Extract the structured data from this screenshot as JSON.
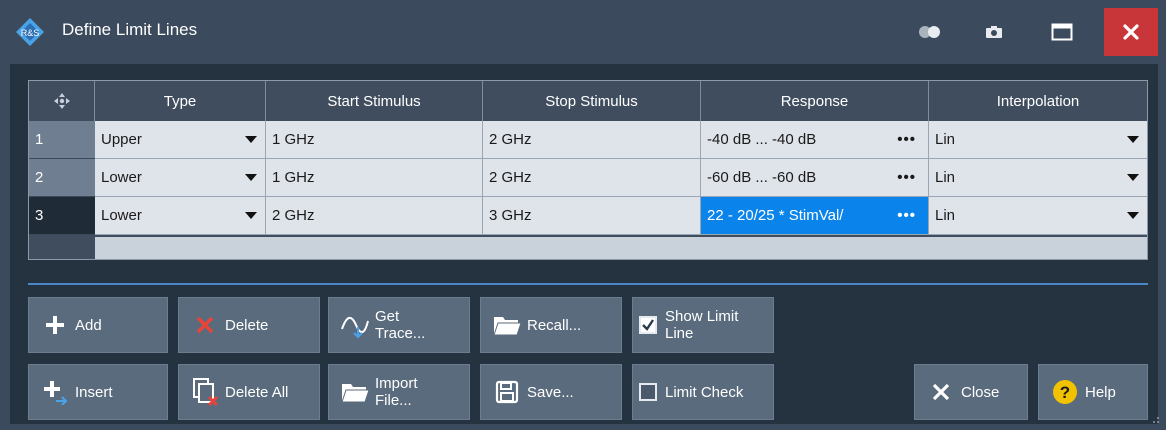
{
  "window": {
    "title": "Define Limit Lines"
  },
  "table": {
    "columns": [
      "Type",
      "Start Stimulus",
      "Stop Stimulus",
      "Response",
      "Interpolation"
    ],
    "rows": [
      {
        "num": "1",
        "type": "Upper",
        "start": "1 GHz",
        "stop": "2 GHz",
        "response": "-40 dB ... -40 dB",
        "interp": "Lin"
      },
      {
        "num": "2",
        "type": "Lower",
        "start": "1 GHz",
        "stop": "2 GHz",
        "response": "-60 dB ... -60 dB",
        "interp": "Lin"
      },
      {
        "num": "3",
        "type": "Lower",
        "start": "2 GHz",
        "stop": "3 GHz",
        "response": "22 - 20/25 * StimVal/",
        "interp": "Lin"
      }
    ]
  },
  "buttons": {
    "add": "Add",
    "delete": "Delete",
    "get_trace_1": "Get",
    "get_trace_2": "Trace...",
    "recall": "Recall...",
    "show_limit_1": "Show Limit",
    "show_limit_2": "Line",
    "insert": "Insert",
    "delete_all": "Delete All",
    "import_1": "Import",
    "import_2": "File...",
    "save": "Save...",
    "limit_check": "Limit Check",
    "close": "Close",
    "help": "Help"
  },
  "state": {
    "show_limit_line": true,
    "limit_check": false
  },
  "colors": {
    "accent": "#0a84ea",
    "close_red": "#c9363a",
    "help_yellow": "#f2c200"
  }
}
